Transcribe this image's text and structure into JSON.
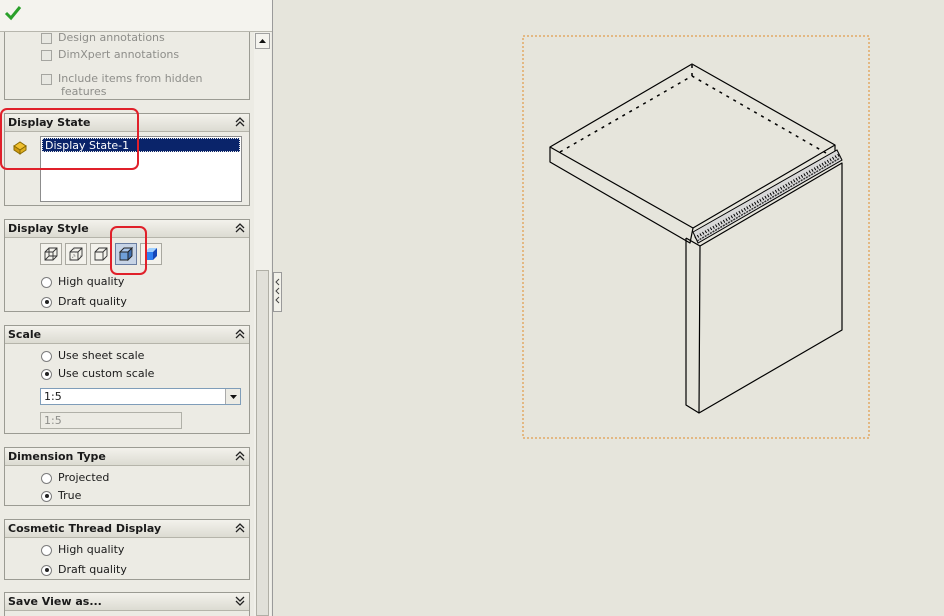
{
  "property_manager": {
    "ok_icon": "check-icon",
    "annotations": {
      "items": [
        {
          "label": "Design annotations",
          "checked": false
        },
        {
          "label": "DimXpert annotations",
          "checked": false
        },
        {
          "label": "Include items from hidden",
          "label_line2": "features",
          "checked": false
        }
      ]
    },
    "display_state": {
      "title": "Display State",
      "icon": "display-state-icon",
      "list": [
        "Display State-1"
      ]
    },
    "display_style": {
      "title": "Display Style",
      "buttons": [
        {
          "name": "wireframe-icon"
        },
        {
          "name": "hidden-lines-visible-icon"
        },
        {
          "name": "hidden-lines-removed-icon"
        },
        {
          "name": "shaded-with-edges-icon",
          "active": true
        },
        {
          "name": "shaded-icon"
        }
      ],
      "options": [
        {
          "label": "High quality",
          "selected": false
        },
        {
          "label": "Draft quality",
          "selected": true
        }
      ]
    },
    "scale": {
      "title": "Scale",
      "options": [
        {
          "label": "Use sheet scale",
          "selected": false
        },
        {
          "label": "Use custom scale",
          "selected": true
        }
      ],
      "combo_value": "1:5",
      "field_value": "1:5"
    },
    "dimension_type": {
      "title": "Dimension Type",
      "options": [
        {
          "label": "Projected",
          "selected": false
        },
        {
          "label": "True",
          "selected": true
        }
      ]
    },
    "cosmetic_thread": {
      "title": "Cosmetic Thread Display",
      "options": [
        {
          "label": "High quality",
          "selected": false
        },
        {
          "label": "Draft quality",
          "selected": true
        }
      ]
    },
    "save_view": {
      "title": "Save View as..."
    }
  },
  "colors": {
    "highlight": "#e0202a",
    "selection": "#0a246a",
    "view_border": "#e08a2a",
    "check": "#2aa02a"
  }
}
